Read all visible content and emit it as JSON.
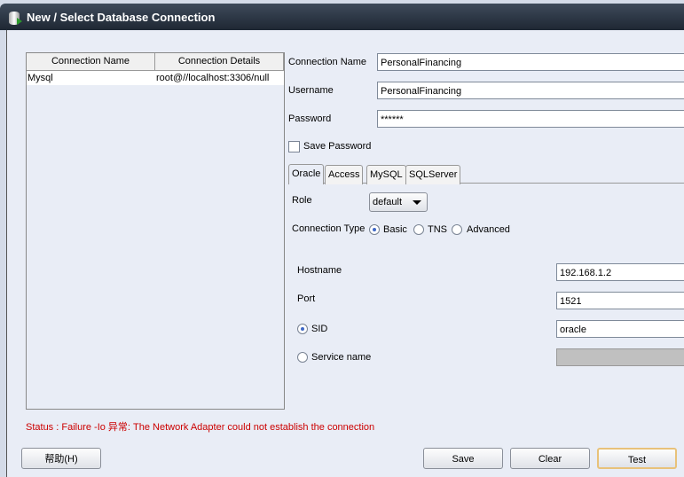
{
  "window": {
    "title": "New / Select Database Connection"
  },
  "table": {
    "columns": [
      "Connection Name",
      "Connection Details"
    ],
    "rows": [
      {
        "name": "Mysql",
        "details": "root@//localhost:3306/null"
      }
    ]
  },
  "form": {
    "connection_name_label": "Connection Name",
    "connection_name": "PersonalFinancing",
    "username_label": "Username",
    "username": "PersonalFinancing",
    "password_label": "Password",
    "password": "******",
    "save_password_label": "Save Password",
    "save_password_checked": false
  },
  "tabs": [
    {
      "label": "Oracle",
      "active": true
    },
    {
      "label": "Access"
    },
    {
      "label": "MySQL"
    },
    {
      "label": "SQLServer"
    }
  ],
  "oracle": {
    "role_label": "Role",
    "role": "default",
    "connection_type_label": "Connection Type",
    "types": [
      "Basic",
      "TNS",
      "Advanced"
    ],
    "selected_type": "Basic",
    "hostname_label": "Hostname",
    "hostname": "192.168.1.2",
    "port_label": "Port",
    "port": "1521",
    "sid_label": "SID",
    "sid": "oracle",
    "service_label": "Service name",
    "selected_id": "SID"
  },
  "status": {
    "text": "Status : Failure -Io 异常: The Network Adapter could not establish the connection",
    "color": "#cc0000"
  },
  "buttons": {
    "help": "帮助(H)",
    "save": "Save",
    "clear": "Clear",
    "test": "Test"
  }
}
